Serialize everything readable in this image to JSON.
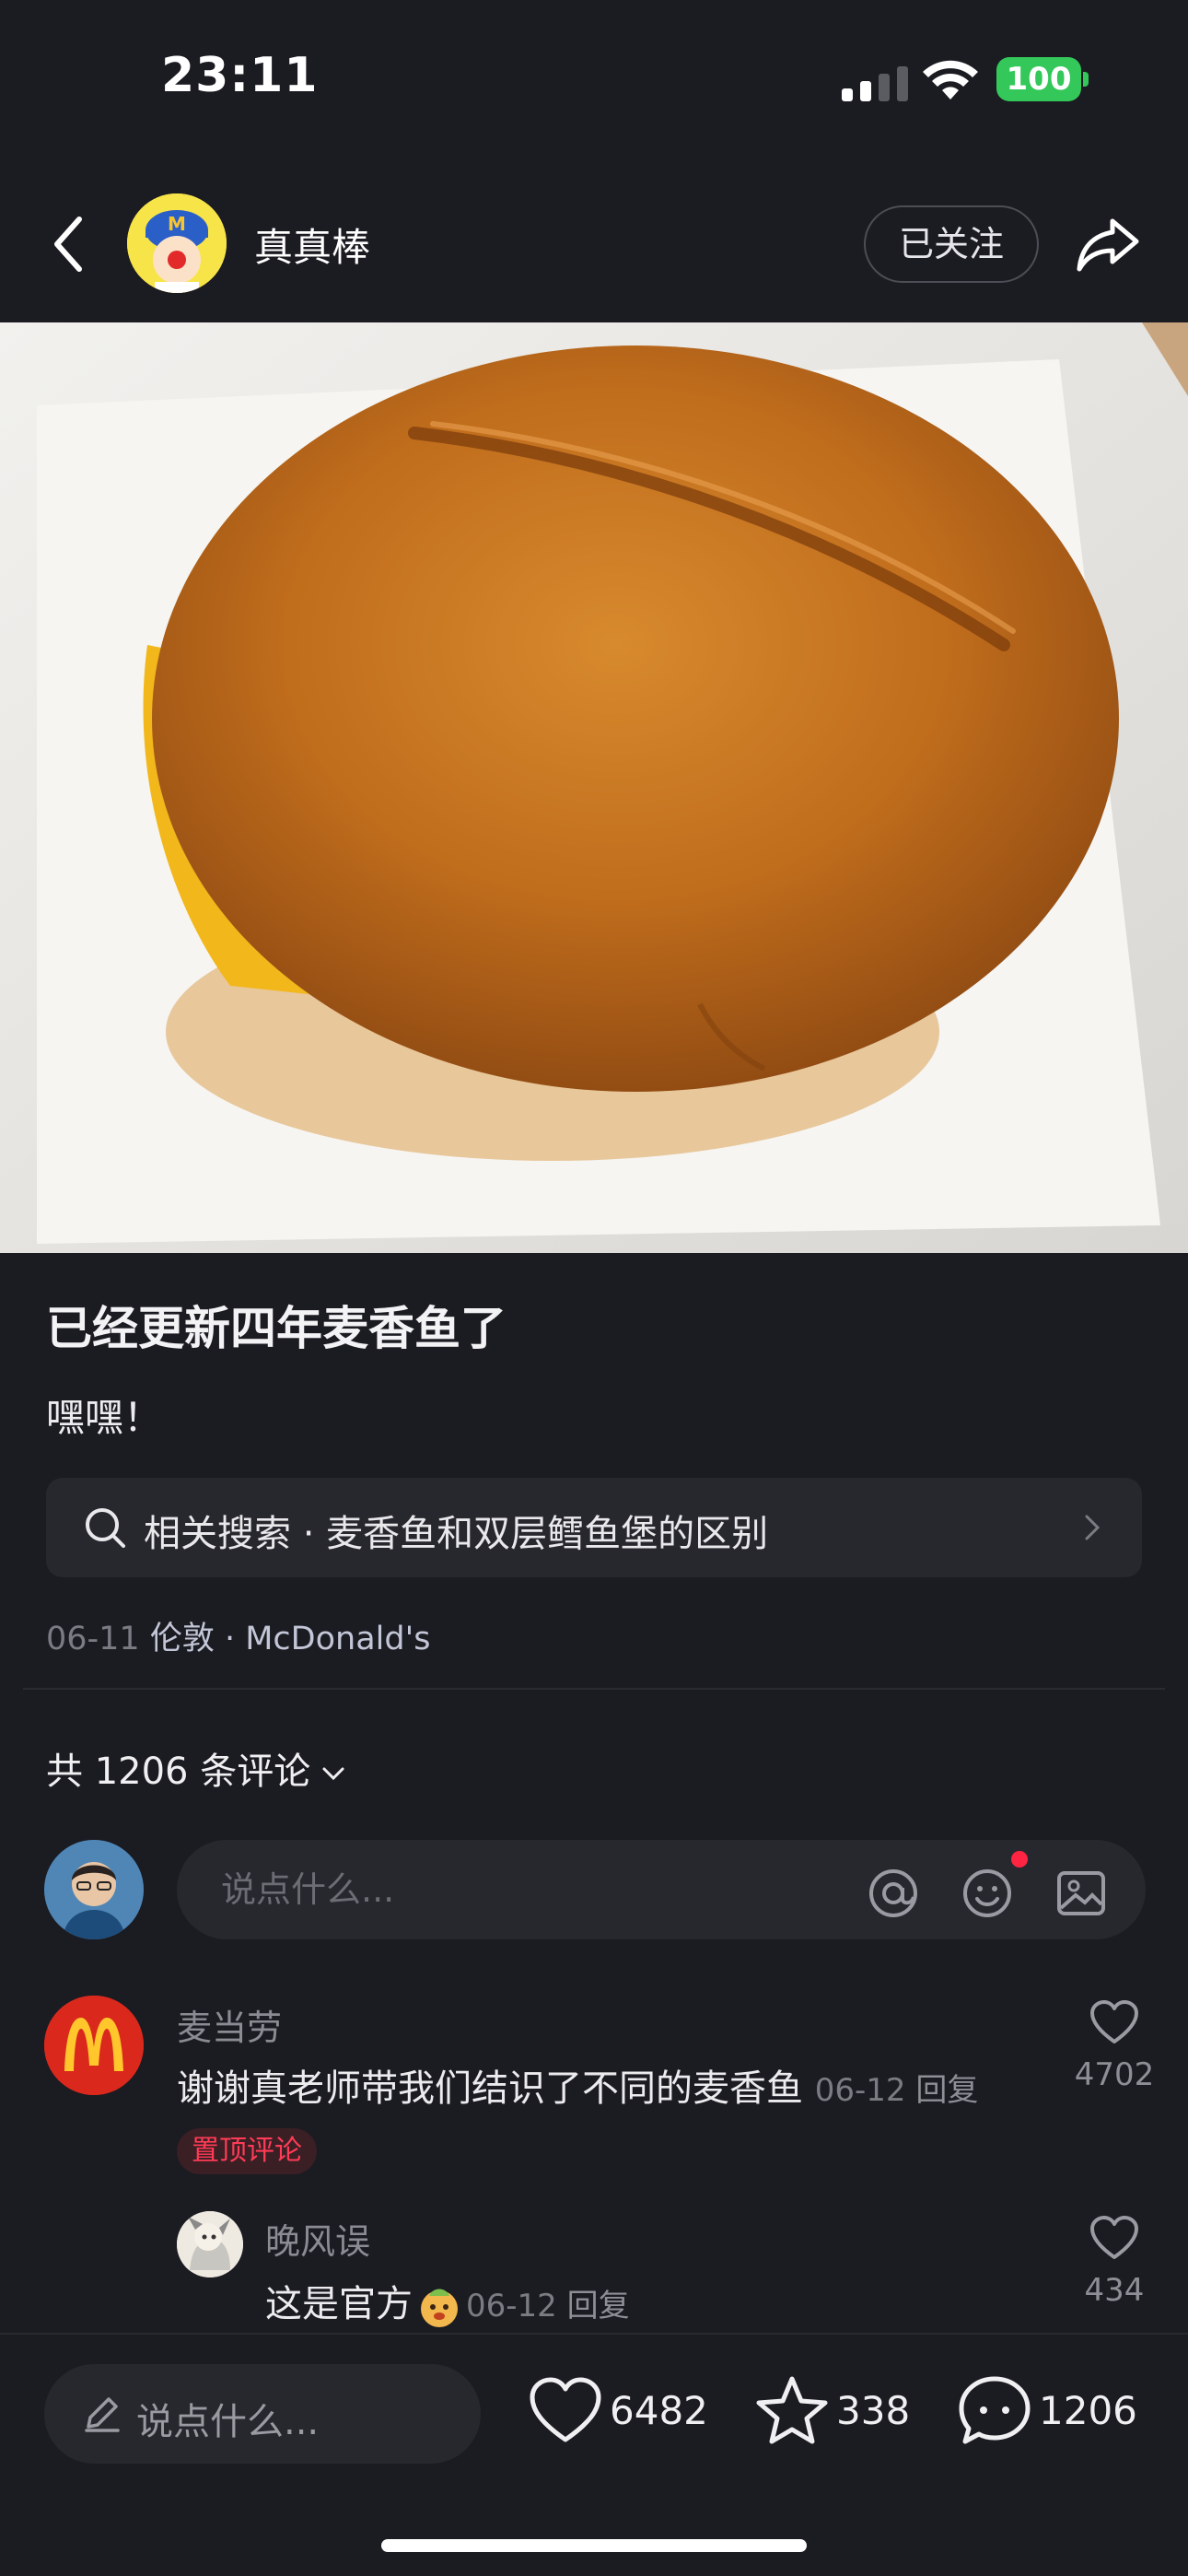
{
  "status_bar": {
    "time": "23:11",
    "battery": "100"
  },
  "header": {
    "author_name": "真真棒",
    "follow_label": "已关注"
  },
  "post": {
    "title": "已经更新四年麦香鱼了",
    "body": "嘿嘿！",
    "related_search": "相关搜索 · 麦香鱼和双层鳕鱼堡的区别",
    "date": "06-11",
    "location": "伦敦 · McDonald's"
  },
  "comments_section": {
    "count_label": "共 1206 条评论",
    "input_placeholder": "说点什么...",
    "comments": [
      {
        "author": "麦当劳",
        "text": "谢谢真老师带我们结识了不同的麦香鱼",
        "date": "06-12",
        "reply_label": "回复",
        "likes": "4702",
        "badge": "置顶评论"
      },
      {
        "author": "晚风误",
        "text": "这是官方",
        "date": "06-12",
        "reply_label": "回复",
        "likes": "434"
      }
    ]
  },
  "bottom_bar": {
    "input_placeholder": "说点什么...",
    "likes": "6482",
    "collects": "338",
    "comments": "1206"
  },
  "colors": {
    "accent_red": "#ff2442",
    "battery_green": "#34c759",
    "mcd_red": "#da291c",
    "mcd_yellow": "#ffc72c"
  }
}
